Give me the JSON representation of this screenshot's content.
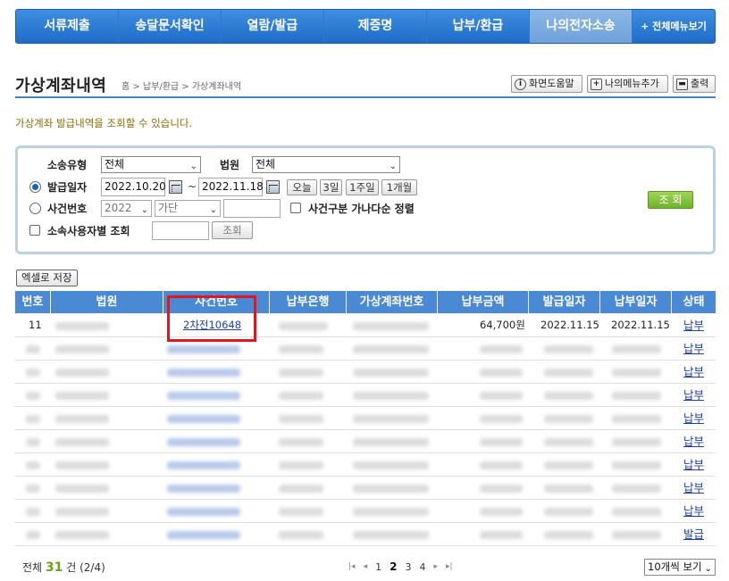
{
  "nav": {
    "items": [
      "서류제출",
      "송달문서확인",
      "열람/발급",
      "제증명",
      "납부/환급",
      "나의전자소송"
    ],
    "all_menu": "+ 전체메뉴보기"
  },
  "header": {
    "title": "가상계좌내역",
    "breadcrumb": "홈 > 납부/환급 > 가상계좌내역",
    "help_btn": "화면도움말",
    "mymenu_btn": "나의메뉴추가",
    "print_btn": "출력"
  },
  "description": "가상계좌 발급내역을 조회할 수 있습니다.",
  "search": {
    "case_type_label": "소송유형",
    "case_type_value": "전체",
    "court_label": "법원",
    "court_value": "전체",
    "issue_date_label": "발급일자",
    "date_from": "2022.10.20",
    "date_sep": "~",
    "date_to": "2022.11.18",
    "quick": [
      "오늘",
      "3일",
      "1주일",
      "1개월"
    ],
    "case_no_label": "사건번호",
    "case_year": "2022",
    "case_kind": "가단",
    "sort_label": "사건구분 가나다순 정렬",
    "sub_user_label": "소속사용자별 조회",
    "sub_user_btn": "조회",
    "search_btn": "조 회"
  },
  "excel_btn": "엑셀로 저장",
  "table": {
    "headers": [
      "번호",
      "법원",
      "사건번호",
      "납부은행",
      "가상계좌번호",
      "납부금액",
      "발급일자",
      "납부일자",
      "상태"
    ],
    "first_row": {
      "no": "11",
      "case_no": "2차전10648",
      "amount": "64,700원",
      "issue_date": "2022.11.15",
      "pay_date": "2022.11.15",
      "status": "납부"
    },
    "statuses": [
      "납부",
      "납부",
      "납부",
      "납부",
      "납부",
      "납부",
      "납부",
      "납부",
      "납부",
      "발급"
    ]
  },
  "footer": {
    "total_prefix": "전체",
    "total_count": "31",
    "total_suffix": "건 (2/4)",
    "pages": [
      "1",
      "2",
      "3",
      "4"
    ],
    "current_page": "2",
    "page_size": "10개씩 보기"
  }
}
